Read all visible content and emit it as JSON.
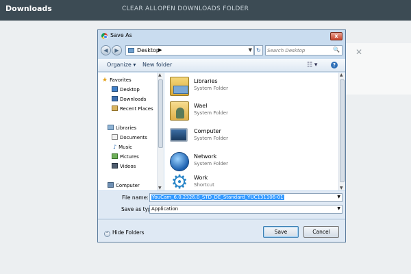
{
  "app": {
    "title": "Downloads",
    "clear_all": "CLEAR ALL",
    "open_folder": "OPEN DOWNLOADS FOLDER",
    "card_close": "✕"
  },
  "dialog": {
    "title": "Save As",
    "close": "x",
    "address": {
      "back": "◀",
      "forward": "▶",
      "location": "Desktop",
      "separator": "▶",
      "dropdown": "▼",
      "refresh": "↻"
    },
    "search": {
      "placeholder": "Search Desktop",
      "icon": "🔍"
    },
    "toolbar": {
      "organize": "Organize ▾",
      "new_folder": "New folder",
      "view": "☷ ▾",
      "help": "?"
    },
    "nav": {
      "favorites": "Favorites",
      "desktop": "Desktop",
      "downloads": "Downloads",
      "recent_places": "Recent Places",
      "libraries": "Libraries",
      "documents": "Documents",
      "music": "Music",
      "pictures": "Pictures",
      "videos": "Videos",
      "computer": "Computer"
    },
    "files": [
      {
        "name": "Libraries",
        "type": "System Folder",
        "icon": "libraries-icon"
      },
      {
        "name": "Wael",
        "type": "System Folder",
        "icon": "user-folder-icon"
      },
      {
        "name": "Computer",
        "type": "System Folder",
        "icon": "computer-icon"
      },
      {
        "name": "Network",
        "type": "System Folder",
        "icon": "network-icon"
      },
      {
        "name": "Work",
        "type": "Shortcut",
        "icon": "gear-icon"
      }
    ],
    "form": {
      "file_name_label": "File name:",
      "file_name_value": "YouCam_6.0.2326.0_STD_DE_Standard_YUC131106-01",
      "save_type_label": "Save as type:",
      "save_type_value": "Application",
      "dropdown": "▼"
    },
    "footer": {
      "hide_folders": "Hide Folders",
      "chevron": "⌃",
      "save": "Save",
      "cancel": "Cancel"
    },
    "scroll": {
      "up": "▲",
      "down": "▼"
    }
  },
  "colors": {
    "topbar": "#3c4b54",
    "dialog_frame": "#c9dcef",
    "selection": "#3399ff"
  }
}
